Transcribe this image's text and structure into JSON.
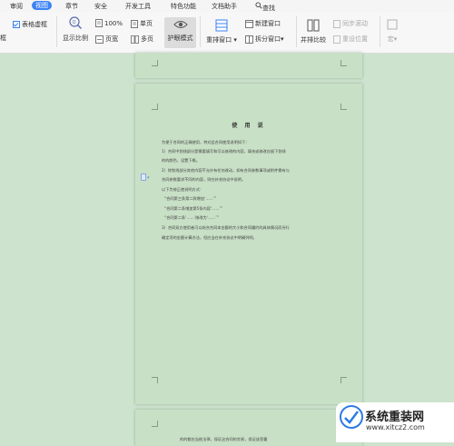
{
  "menu": {
    "items": [
      "审阅",
      "视图",
      "章节",
      "安全",
      "开发工具",
      "特色功能",
      "文档助手",
      "查找"
    ],
    "active": "视图"
  },
  "ribbon": {
    "table_gridlines_label": "表格虚框",
    "left_cut_label": "框",
    "zoom_label": "显示比例",
    "hundred_label": "100%",
    "page_width_label": "页宽",
    "single_page_label": "单页",
    "multi_page_label": "多页",
    "eye_mode_label": "护眼模式",
    "rearrange_label": "重排窗口",
    "new_window_label": "新建窗口",
    "split_window_label": "拆分窗口",
    "side_by_side_label": "并排比较",
    "sync_scroll_label": "同步滚动",
    "reset_position_label": "重设位置",
    "macro_label": "宏"
  },
  "document": {
    "title": "使 用 说",
    "lines": [
      "为便于合同的正确使用，特对此合同使用说明如下：",
      "1）合同中划线部分是需要填写和可以修改的内容，填充或修改应留下划线",
      "的的颜色，设置下格。",
      "2）除划线部分其他内容不允许有任何改动，如有合同参数事项或附件需有与",
      "合同参数要求不同的内容，则在补充协议中说明。",
      "以下为修正使说明方式：",
      "“合同第三条第二款增加‘……’”",
      "“合同第二条增加第5条内容‘……’”",
      "“合同第二条‘……’修改为‘……’”",
      "3）合同双方使用者可以结合合同本金额的大小和合同履约的具体情况而另行",
      "确定项的金额计算办法，但应当在补充协议中明确列明。"
    ],
    "next_page_line": "的的都应当依法律，保证这合同的交易，保证该签署"
  },
  "watermark": {
    "brand": "系统重装网",
    "url": "www.xitcz2.com"
  },
  "colors": {
    "background": "#cde3cd",
    "page": "#c8e0c6",
    "accent": "#3b82f6",
    "logo_red": "#e53935"
  }
}
